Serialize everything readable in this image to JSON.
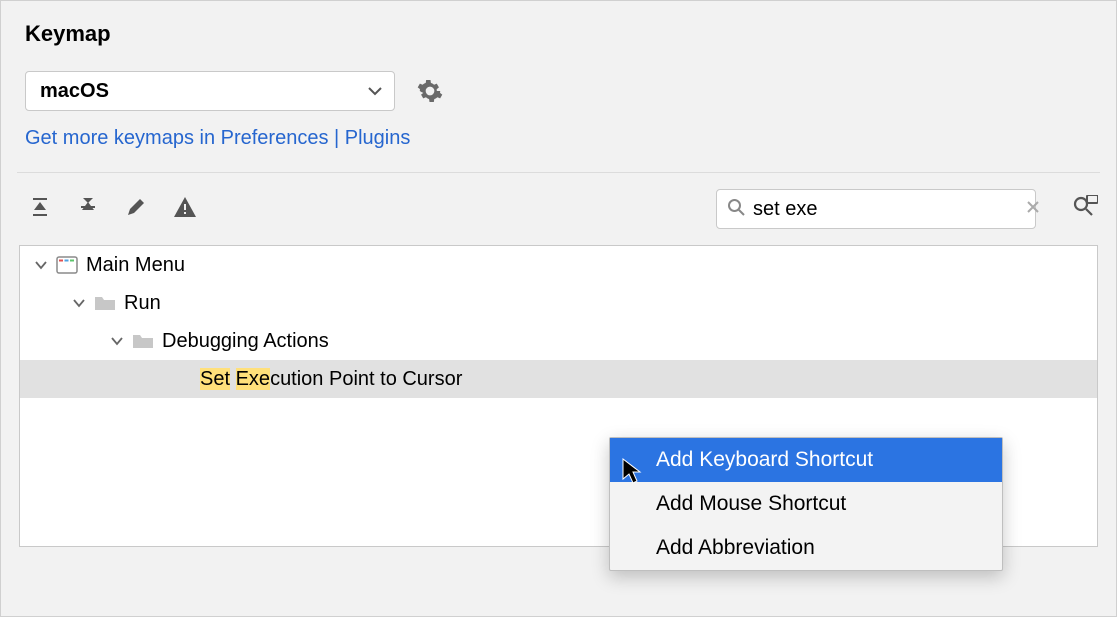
{
  "title": "Keymap",
  "keymap_select": {
    "value": "macOS"
  },
  "more_keymaps_link": "Get more keymaps in Preferences | Plugins",
  "search": {
    "value": "set exe"
  },
  "tree": {
    "root": "Main Menu",
    "child1": "Run",
    "child2": "Debugging Actions",
    "action_plain_prefix": "",
    "action_hl1": "Set",
    "action_sep": " ",
    "action_hl2": "Exe",
    "action_rest": "cution Point to Cursor"
  },
  "context_menu": {
    "item1": "Add Keyboard Shortcut",
    "item2": "Add Mouse Shortcut",
    "item3": "Add Abbreviation"
  }
}
